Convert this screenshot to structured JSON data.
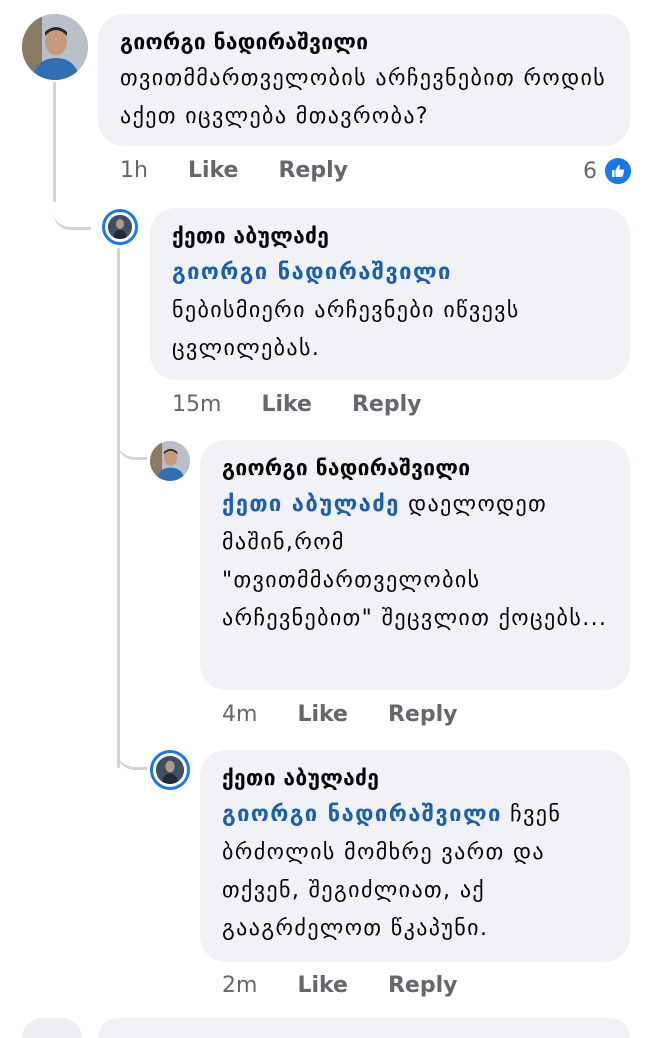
{
  "comments": [
    {
      "author": "გიორგი ნადირაშვილი",
      "mention": "",
      "text": "თვითმმართველობის არჩევნებით როდის აქეთ იცვლება მთავრობა?",
      "time": "1h",
      "like": "Like",
      "reply": "Reply",
      "reaction_count": "6"
    },
    {
      "author": "ქეთი აბულაძე",
      "mention": "გიორგი ნადირაშვილი",
      "text": "ნებისმიერი არჩევნები იწვევს ცვლილებას.",
      "time": "15m",
      "like": "Like",
      "reply": "Reply"
    },
    {
      "author": "გიორგი ნადირაშვილი",
      "mention": "ქეთი აბულაძე",
      "text": " დაელოდეთ მაშინ,რომ \"თვითმმართველობის არჩევნებით\" შეცვლით ქოცებს...",
      "time": "4m",
      "like": "Like",
      "reply": "Reply"
    },
    {
      "author": "ქეთი აბულაძე",
      "mention": "გიორგი ნადირაშვილი",
      "text": " ჩვენ ბრძოლის მომხრე ვართ და თქვენ, შეგიძლიათ, აქ გააგრძელოთ წკაპუნი.",
      "time": "2m",
      "like": "Like",
      "reply": "Reply"
    }
  ],
  "icons": {
    "like_reaction": "thumbs-up-icon"
  },
  "colors": {
    "bubble": "#f0f2f5",
    "mention": "#1a5fb4",
    "meta": "#65676b",
    "reaction": "#1877f2"
  }
}
